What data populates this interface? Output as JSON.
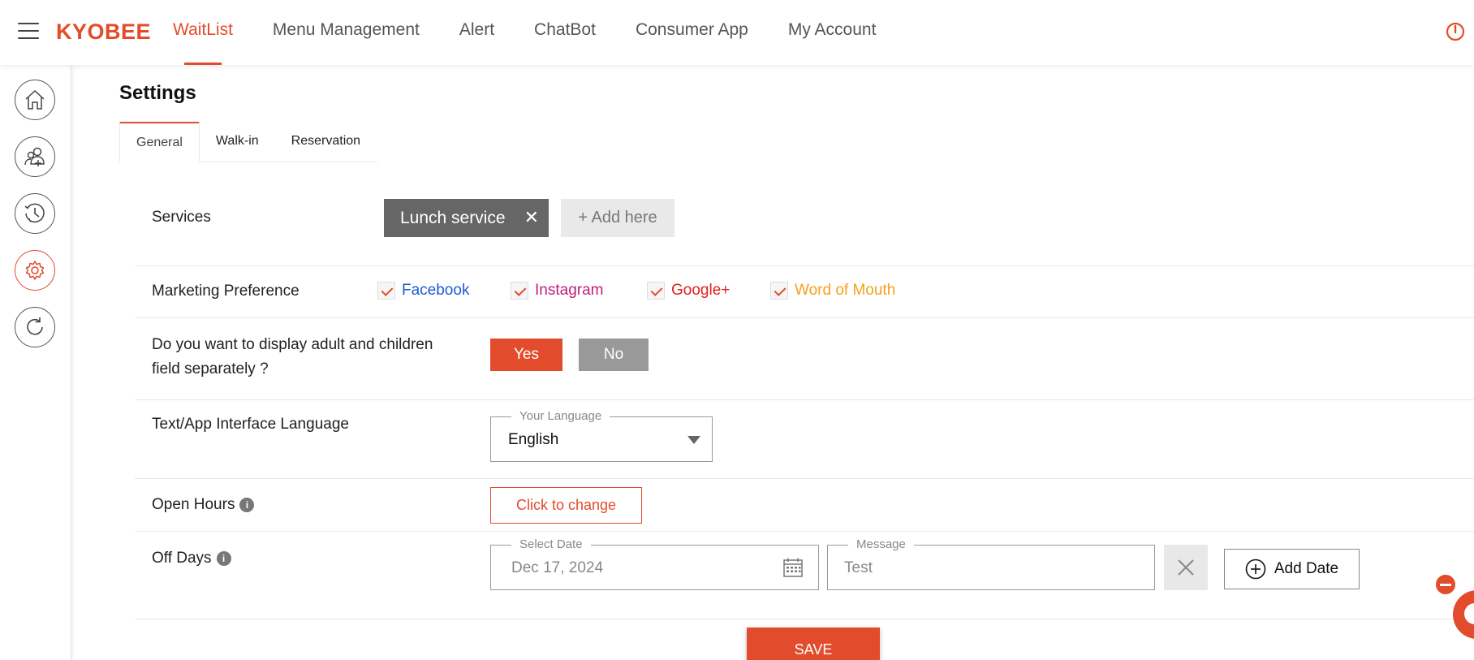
{
  "header": {
    "brand": "KYOBEE",
    "nav": [
      {
        "label": "WaitList",
        "active": true
      },
      {
        "label": "Menu Management",
        "active": false
      },
      {
        "label": "Alert",
        "active": false
      },
      {
        "label": "ChatBot",
        "active": false
      },
      {
        "label": "Consumer App",
        "active": false
      },
      {
        "label": "My Account",
        "active": false
      }
    ],
    "logout_icon": "power-icon"
  },
  "sidebar": {
    "items": [
      {
        "icon": "home-icon",
        "active": false
      },
      {
        "icon": "add-user-icon",
        "active": false
      },
      {
        "icon": "history-icon",
        "active": false
      },
      {
        "icon": "gear-icon",
        "active": true
      },
      {
        "icon": "refresh-icon",
        "active": false
      }
    ]
  },
  "page": {
    "title": "Settings",
    "tabs": [
      {
        "label": "General",
        "active": true
      },
      {
        "label": "Walk-in",
        "active": false
      },
      {
        "label": "Reservation",
        "active": false
      }
    ]
  },
  "services": {
    "label": "Services",
    "chips": [
      "Lunch service"
    ],
    "add_label": "+ Add here"
  },
  "marketing": {
    "label": "Marketing Preference",
    "options": [
      {
        "label": "Facebook",
        "checked": true,
        "color": "#1a5cd1"
      },
      {
        "label": "Instagram",
        "checked": true,
        "color": "#c21e7a"
      },
      {
        "label": "Google+",
        "checked": true,
        "color": "#e0211e"
      },
      {
        "label": "Word of Mouth",
        "checked": true,
        "color": "#f4a21a"
      }
    ]
  },
  "adult_children": {
    "label_line1": "Do you want to display adult and children",
    "label_line2": "field separately ?",
    "yes_label": "Yes",
    "no_label": "No",
    "selected": "Yes"
  },
  "language": {
    "label": "Text/App Interface Language",
    "legend": "Your Language",
    "value": "English"
  },
  "open_hours": {
    "label": "Open Hours",
    "button": "Click to change"
  },
  "off_days": {
    "label": "Off Days",
    "date_legend": "Select Date",
    "date_value": "Dec 17, 2024",
    "message_legend": "Message",
    "message_value": "Test",
    "add_label": "Add Date"
  },
  "actions": {
    "save_label": "SAVE"
  },
  "colors": {
    "accent": "#e24b2b",
    "no_button": "#999999",
    "chip": "#666666"
  }
}
